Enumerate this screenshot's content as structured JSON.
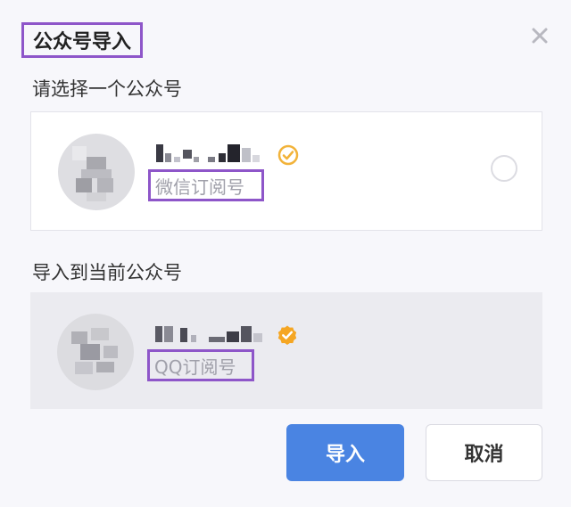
{
  "dialog": {
    "title": "公众号导入",
    "select_label": "请选择一个公众号",
    "current_label": "导入到当前公众号"
  },
  "source_account": {
    "type": "微信订阅号",
    "verified_icon": "verified-check-icon",
    "badge_color": "#f2b33a",
    "selected": false
  },
  "target_account": {
    "type": "QQ订阅号",
    "verified_icon": "verified-check-icon",
    "badge_color": "#f5a623"
  },
  "buttons": {
    "import": "导入",
    "cancel": "取消"
  },
  "colors": {
    "primary": "#4a84e2",
    "highlight": "#8e56c9"
  }
}
